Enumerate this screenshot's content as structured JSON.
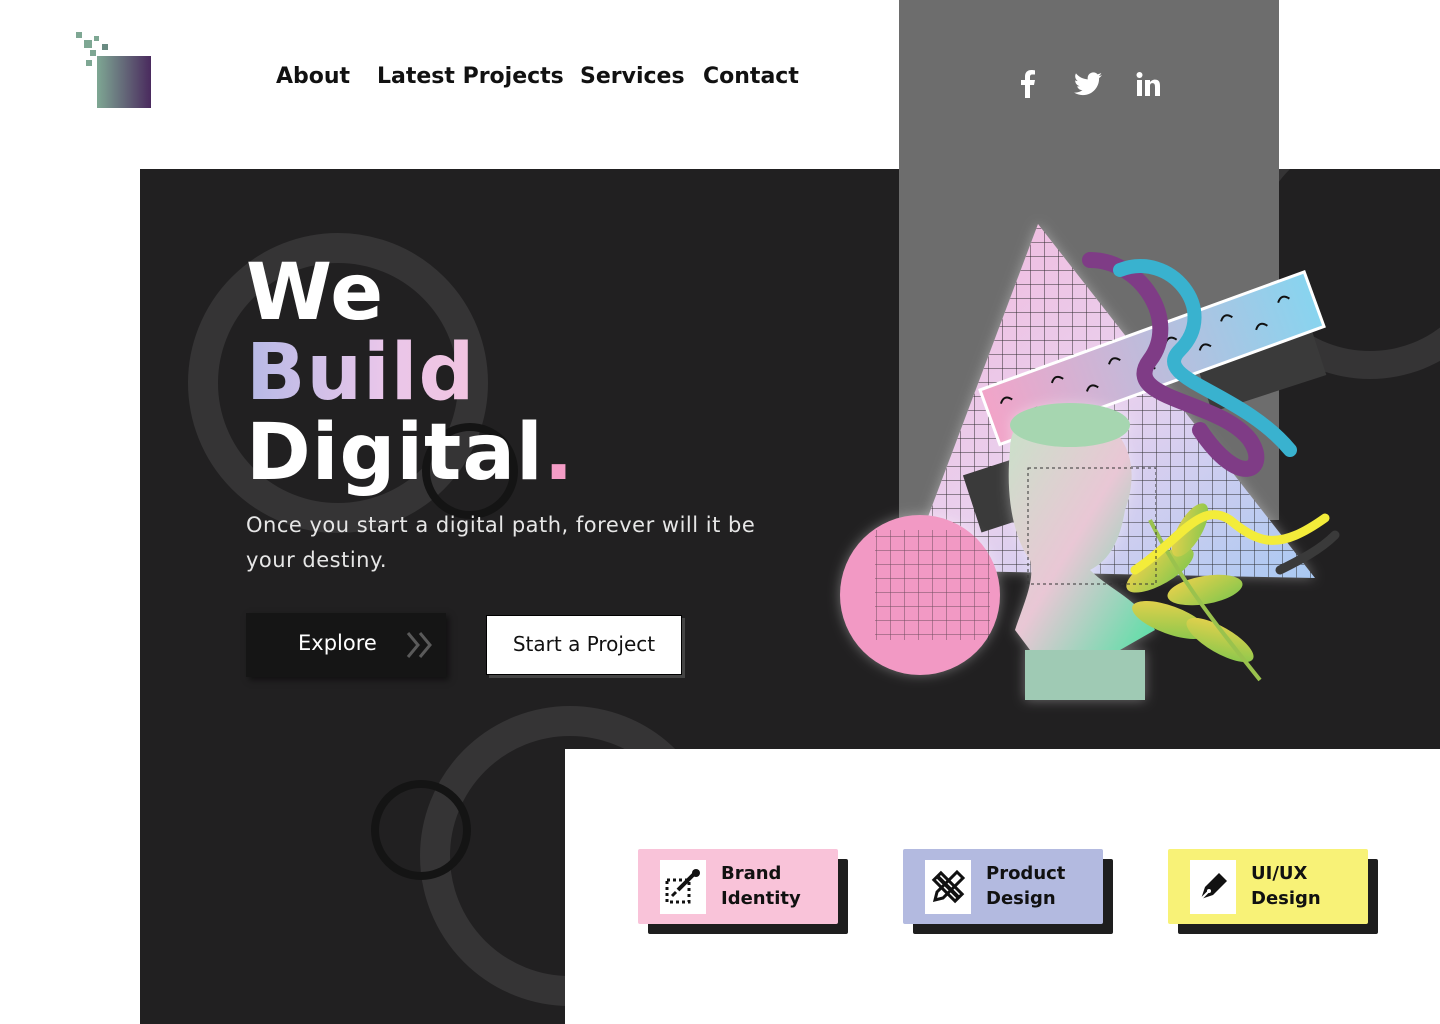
{
  "nav": {
    "items": [
      {
        "label": "About"
      },
      {
        "label": "Latest Projects"
      },
      {
        "label": "Services"
      },
      {
        "label": "Contact"
      }
    ]
  },
  "social": [
    {
      "icon": "facebook-icon",
      "glyph": "f"
    },
    {
      "icon": "twitter-icon"
    },
    {
      "icon": "linkedin-icon",
      "glyph": "in"
    }
  ],
  "hero": {
    "line1": "We",
    "line2": "Build",
    "line3": "Digital",
    "line3_dot": ".",
    "subtitle": "Once you start a digital path, forever will it be your destiny.",
    "explore_label": "Explore",
    "start_label": "Start a Project"
  },
  "services": [
    {
      "line1": "Brand",
      "line2": "Identity",
      "icon": "brand-identity-icon",
      "color": "#f9c3d9"
    },
    {
      "line1": "Product",
      "line2": "Design",
      "icon": "product-design-icon",
      "color": "#b3bae0"
    },
    {
      "line1": "UI/UX",
      "line2": "Design",
      "icon": "pen-tool-icon",
      "color": "#f8f277"
    }
  ],
  "colors": {
    "dark_bg": "#212021",
    "grey_panel": "#6d6d6d",
    "accent_pink": "#f49cc6",
    "accent_lavender": "#b6b9e6"
  }
}
